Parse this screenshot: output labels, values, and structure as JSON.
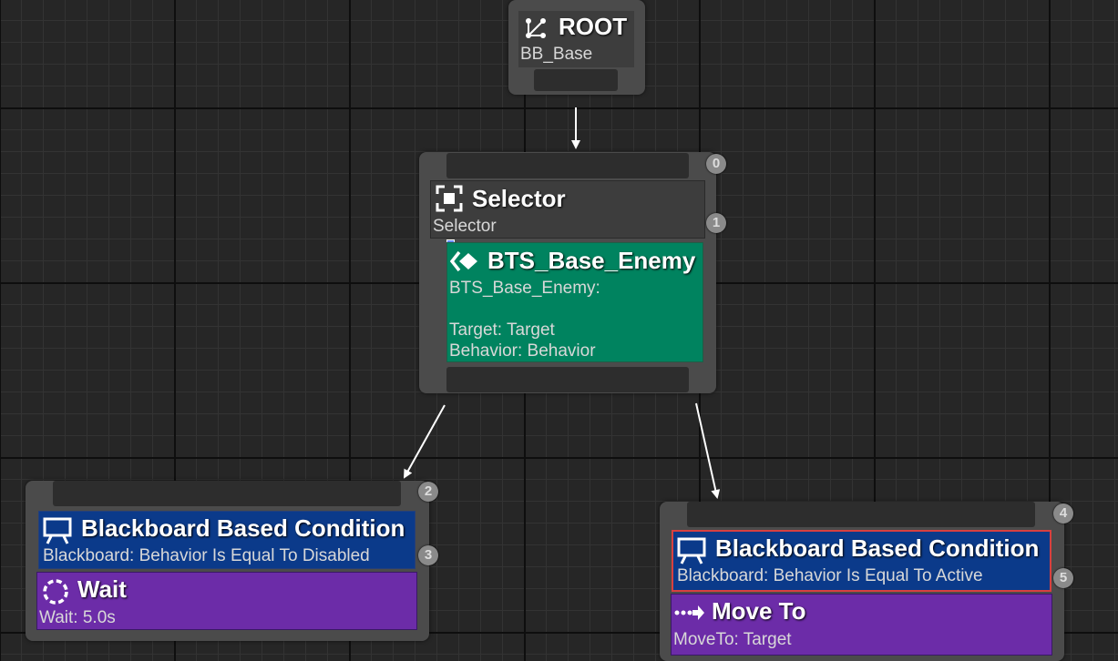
{
  "root": {
    "title": "ROOT",
    "subtitle": "BB_Base",
    "icon": "root-tree-icon"
  },
  "selector": {
    "title": "Selector",
    "subtitle": "Selector",
    "icon": "selector-icon",
    "badges": [
      "0",
      "1"
    ],
    "service": {
      "title": "BTS_Base_Enemy",
      "icon": "service-icon",
      "lines": [
        "BTS_Base_Enemy:",
        "",
        "Target: Target",
        "Behavior: Behavior"
      ],
      "color": "#00835f"
    }
  },
  "left_branch": {
    "badges": [
      "2",
      "3"
    ],
    "decorator": {
      "title": "Blackboard Based Condition",
      "subtitle": "Blackboard: Behavior Is Equal To Disabled",
      "icon": "blackboard-icon",
      "color": "#0b3a8a"
    },
    "task": {
      "title": "Wait",
      "subtitle": "Wait: 5.0s",
      "icon": "wait-icon",
      "color": "#6c2ca8"
    }
  },
  "right_branch": {
    "badges": [
      "4",
      "5"
    ],
    "decorator": {
      "title": "Blackboard Based Condition",
      "subtitle": "Blackboard: Behavior Is Equal To Active",
      "icon": "blackboard-icon",
      "color": "#0b3a8a",
      "highlight": "#d84040"
    },
    "task": {
      "title": "Move To",
      "subtitle": "MoveTo: Target",
      "icon": "move-to-icon",
      "color": "#6c2ca8"
    }
  }
}
